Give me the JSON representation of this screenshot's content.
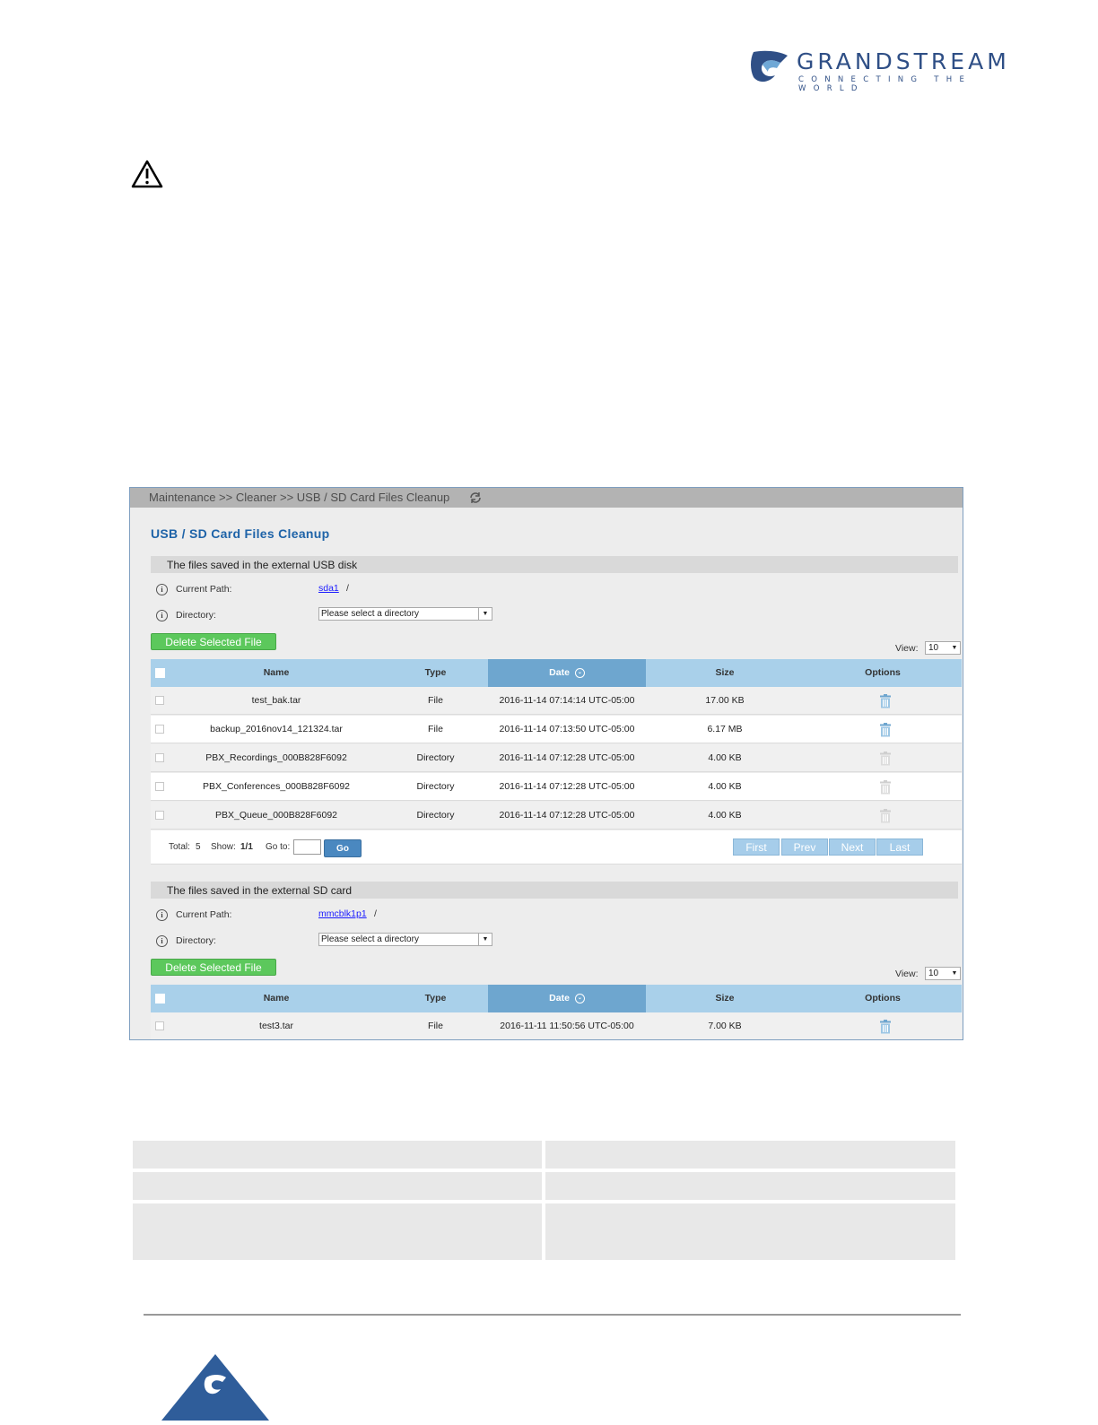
{
  "brand": {
    "name": "GRANDSTREAM",
    "tagline": "CONNECTING THE WORLD",
    "blue": "#2f4f86"
  },
  "warning_icon": "warning-triangle-icon",
  "screenshot": {
    "breadcrumb": "Maintenance >> Cleaner >> USB / SD Card Files Cleanup",
    "title": "USB / SD Card Files Cleanup",
    "accent": "#1e63a8",
    "usb": {
      "section_title": "The files saved in the external USB disk",
      "current_path_label": "Current Path:",
      "path_link": "sda1",
      "path_slash": "/",
      "directory_label": "Directory:",
      "directory_value": "Please select a directory",
      "delete_label": "Delete Selected File",
      "view_label": "View:",
      "view_value": "10",
      "columns": [
        "Name",
        "Type",
        "Date",
        "Size",
        "Options"
      ],
      "rows": [
        {
          "name": "test_bak.tar",
          "type": "File",
          "date": "2016-11-14 07:14:14 UTC-05:00",
          "size": "17.00 KB"
        },
        {
          "name": "backup_2016nov14_121324.tar",
          "type": "File",
          "date": "2016-11-14 07:13:50 UTC-05:00",
          "size": "6.17 MB"
        },
        {
          "name": "PBX_Recordings_000B828F6092",
          "type": "Directory",
          "date": "2016-11-14 07:12:28 UTC-05:00",
          "size": "4.00 KB"
        },
        {
          "name": "PBX_Conferences_000B828F6092",
          "type": "Directory",
          "date": "2016-11-14 07:12:28 UTC-05:00",
          "size": "4.00 KB"
        },
        {
          "name": "PBX_Queue_000B828F6092",
          "type": "Directory",
          "date": "2016-11-14 07:12:28 UTC-05:00",
          "size": "4.00 KB"
        }
      ],
      "pager": {
        "total_label": "Total:",
        "total": "5",
        "show_label": "Show:",
        "show": "1/1",
        "goto_label": "Go to:",
        "go": "Go",
        "first": "First",
        "prev": "Prev",
        "next": "Next",
        "last": "Last"
      }
    },
    "sd": {
      "section_title": "The files saved in the external SD card",
      "current_path_label": "Current Path:",
      "path_link": "mmcblk1p1",
      "path_slash": "/",
      "directory_label": "Directory:",
      "directory_value": "Please select a directory",
      "delete_label": "Delete Selected File",
      "view_label": "View:",
      "view_value": "10",
      "columns": [
        "Name",
        "Type",
        "Date",
        "Size",
        "Options"
      ],
      "rows": [
        {
          "name": "test3.tar",
          "type": "File",
          "date": "2016-11-11 11:50:56 UTC-05:00",
          "size": "7.00 KB"
        }
      ]
    }
  }
}
